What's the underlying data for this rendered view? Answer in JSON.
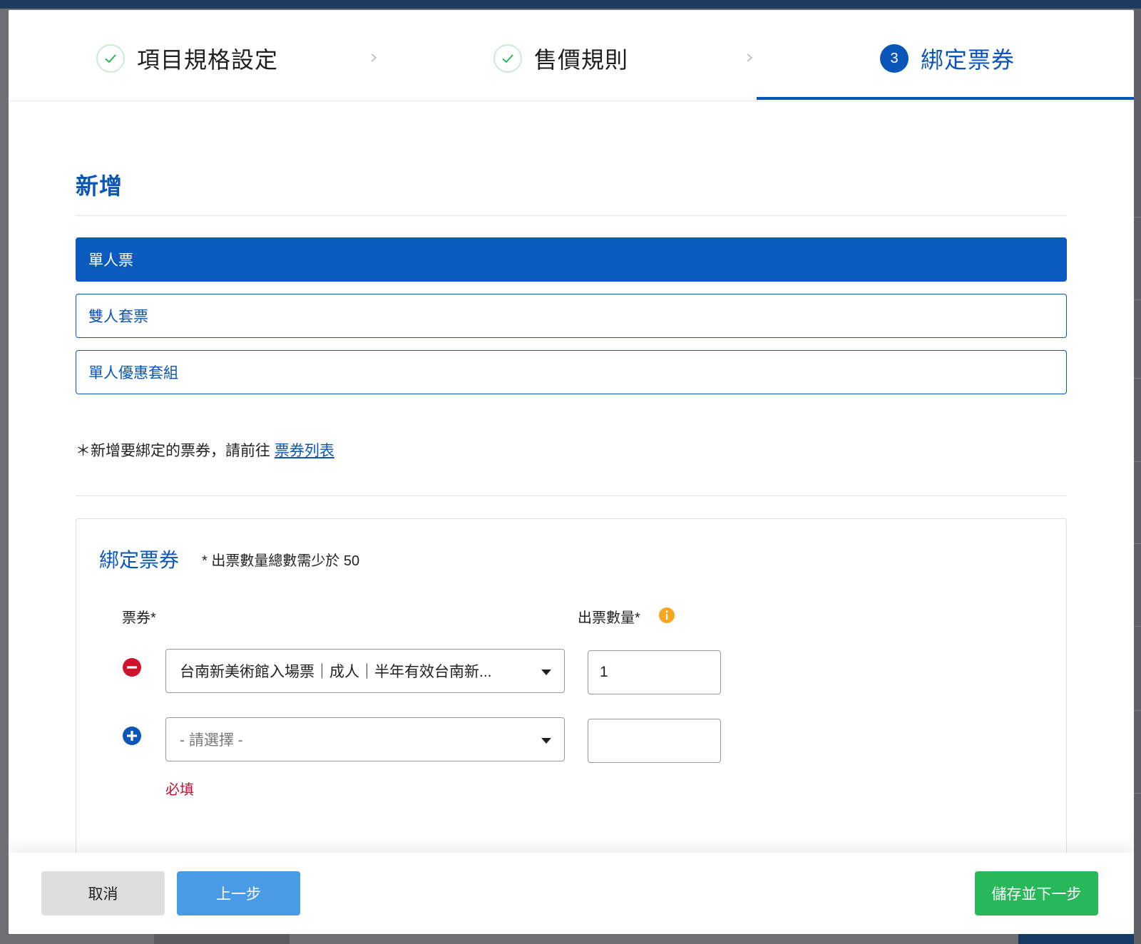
{
  "stepper": {
    "steps": [
      {
        "label": "項目規格設定",
        "status": "done"
      },
      {
        "label": "售價規則",
        "status": "done"
      },
      {
        "label": "綁定票券",
        "status": "active",
        "number": "3"
      }
    ],
    "accent": "#0a56b8",
    "done_color": "#28b85a"
  },
  "page": {
    "title": "新增",
    "options": [
      {
        "label": "單人票",
        "selected": true
      },
      {
        "label": "雙人套票",
        "selected": false
      },
      {
        "label": "單人優惠套組",
        "selected": false
      }
    ],
    "note_prefix": "＊新增要綁定的票券，請前往 ",
    "note_link": "票券列表"
  },
  "binding": {
    "title": "綁定票券",
    "hint": "* 出票數量總數需少於 50",
    "ticket_col_label": "票券*",
    "qty_col_label": "出票數量*",
    "rows": [
      {
        "ticket": "台南新美術館入場票｜成人｜半年有效台南新...",
        "qty": "1",
        "action": "remove-icon"
      },
      {
        "ticket": "",
        "placeholder": "- 請選擇 -",
        "qty": "",
        "action": "add-icon"
      }
    ],
    "required_msg": "必填"
  },
  "footer": {
    "cancel_label": "取消",
    "prev_label": "上一步",
    "next_label": "儲存並下一步"
  }
}
